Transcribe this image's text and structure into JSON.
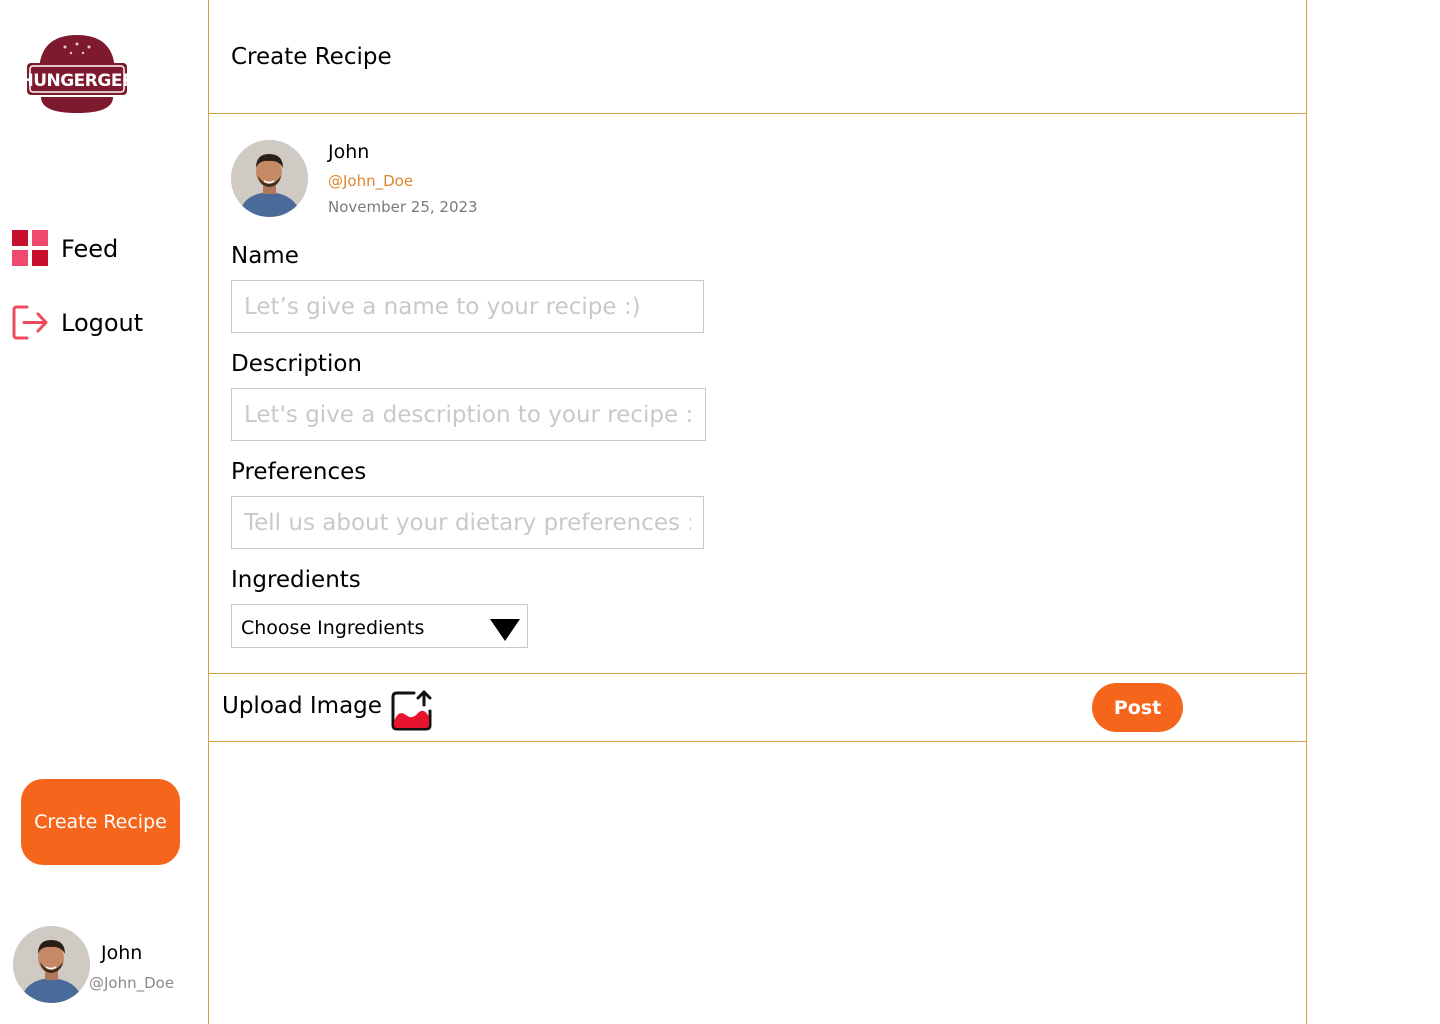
{
  "brand": {
    "logo_text": "HUNGERGER",
    "color": "#7d1a2e"
  },
  "sidebar": {
    "items": [
      {
        "label": "Feed",
        "icon": "grid-icon"
      },
      {
        "label": "Logout",
        "icon": "logout-icon"
      }
    ],
    "create_button_label": "Create Recipe",
    "user": {
      "name": "John",
      "handle": "@John_Doe"
    }
  },
  "main": {
    "title": "Create Recipe",
    "author": {
      "name": "John",
      "handle": "@John_Doe",
      "date": "November 25, 2023"
    },
    "form": {
      "name": {
        "label": "Name",
        "placeholder": "Let’s give a name to your recipe :)",
        "value": ""
      },
      "description": {
        "label": "Description",
        "placeholder": "Let's give a description to your recipe :)",
        "value": ""
      },
      "preferences": {
        "label": "Preferences",
        "placeholder": "Tell us about your dietary preferences :)",
        "value": ""
      },
      "ingredients": {
        "label": "Ingredients",
        "selected": "Choose Ingredients"
      }
    },
    "upload_label": "Upload Image",
    "post_button_label": "Post"
  },
  "colors": {
    "accent": "#f5661c",
    "divider": "#d4a04a",
    "handle": "#e0862a",
    "feed_icon": "#e0163d"
  }
}
